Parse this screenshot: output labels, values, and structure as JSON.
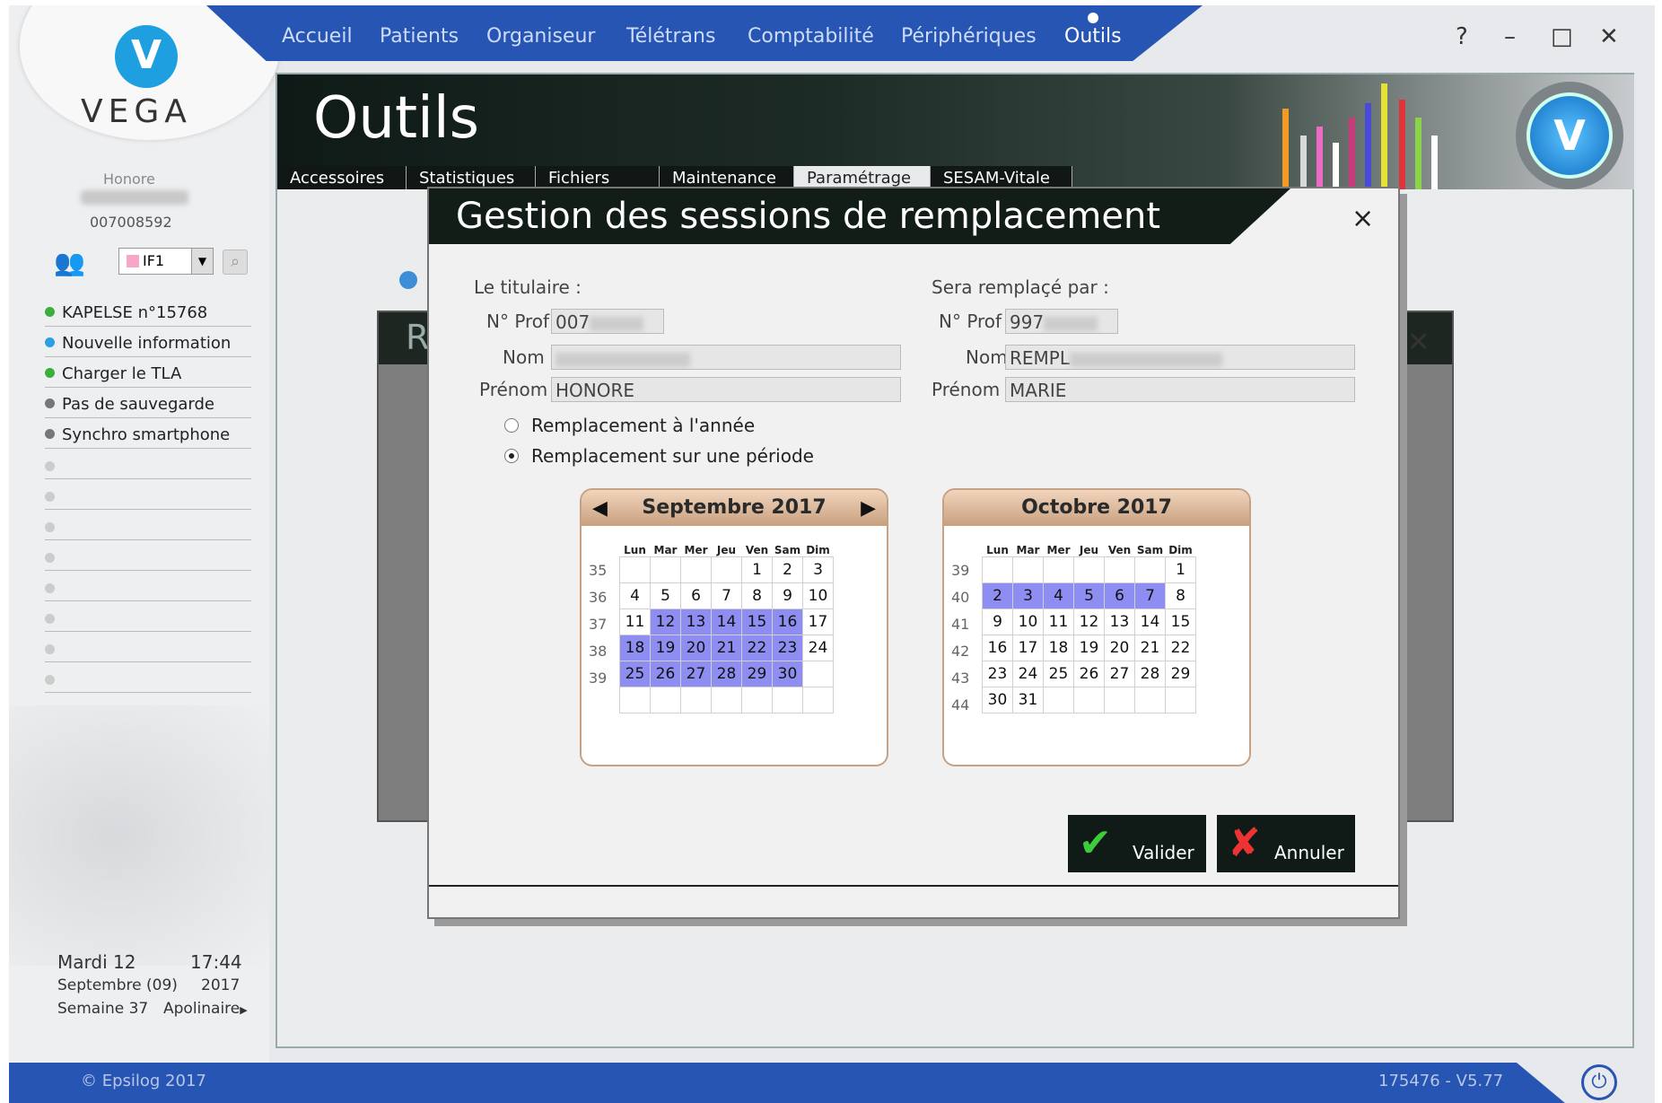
{
  "nav": {
    "items": [
      {
        "label": "Accueil"
      },
      {
        "label": "Patients"
      },
      {
        "label": "Organiseur"
      },
      {
        "label": "Télétrans"
      },
      {
        "label": "Comptabilité"
      },
      {
        "label": "Périphériques"
      },
      {
        "label": "Outils"
      }
    ],
    "active": "Outils"
  },
  "window_controls": {
    "help": "?",
    "minimize": "–",
    "maximize": "□",
    "close": "✕"
  },
  "sidebar": {
    "logo_text": "VEGA",
    "user_first": "Honore",
    "user_id": "007008592",
    "if_label": "IF1",
    "links": [
      {
        "label": "KAPELSE n°15768",
        "color": "#3cae3c"
      },
      {
        "label": "Nouvelle information",
        "color": "#2a9fe6"
      },
      {
        "label": "Charger le TLA",
        "color": "#3cae3c"
      },
      {
        "label": "Pas de sauvegarde",
        "color": "#777777"
      },
      {
        "label": "Synchro smartphone",
        "color": "#777777"
      }
    ],
    "date": {
      "day": "Mardi 12",
      "time": "17:44",
      "month": "Septembre (09)",
      "year": "2017",
      "week": "Semaine 37",
      "saint": "Apolinaire"
    }
  },
  "header": {
    "title": "Outils",
    "tabs": [
      {
        "label": "Accessoires"
      },
      {
        "label": "Statistiques"
      },
      {
        "label": "Fichiers"
      },
      {
        "label": "Maintenance"
      },
      {
        "label": "Paramétrage"
      },
      {
        "label": "SESAM-Vitale"
      }
    ],
    "active_tab": "Paramétrage"
  },
  "background_dialog": {
    "title_partial": "Re"
  },
  "dialog": {
    "title": "Gestion des sessions de remplacement",
    "close": "×",
    "titulaire": {
      "heading": "Le titulaire :",
      "nprof_label": "N° Prof",
      "nprof_value": "007",
      "nom_label": "Nom",
      "prenom_label": "Prénom",
      "prenom_value": "HONORE"
    },
    "remplacant": {
      "heading": "Sera remplaçé par :",
      "nprof_label": "N° Prof",
      "nprof_value": "997",
      "nom_label": "Nom",
      "nom_value": "REMPL",
      "prenom_label": "Prénom",
      "prenom_value": "MARIE"
    },
    "options": [
      {
        "label": "Remplacement à l'année",
        "checked": false
      },
      {
        "label": "Remplacement sur une période",
        "checked": true
      }
    ],
    "calendars": [
      {
        "title": "Septembre 2017",
        "weekdays": [
          "Lun",
          "Mar",
          "Mer",
          "Jeu",
          "Ven",
          "Sam",
          "Dim"
        ],
        "weeks": [
          "35",
          "36",
          "37",
          "38",
          "39",
          ""
        ],
        "days": [
          [
            "",
            "",
            "",
            "",
            "1",
            "2",
            "3"
          ],
          [
            "4",
            "5",
            "6",
            "7",
            "8",
            "9",
            "10"
          ],
          [
            "11",
            "12",
            "13",
            "14",
            "15",
            "16",
            "17"
          ],
          [
            "18",
            "19",
            "20",
            "21",
            "22",
            "23",
            "24"
          ],
          [
            "25",
            "26",
            "27",
            "28",
            "29",
            "30",
            ""
          ],
          [
            "",
            "",
            "",
            "",
            "",
            "",
            ""
          ]
        ],
        "selected": [
          "12",
          "13",
          "14",
          "15",
          "16",
          "18",
          "19",
          "20",
          "21",
          "22",
          "23",
          "25",
          "26",
          "27",
          "28",
          "29",
          "30"
        ]
      },
      {
        "title": "Octobre 2017",
        "weekdays": [
          "Lun",
          "Mar",
          "Mer",
          "Jeu",
          "Ven",
          "Sam",
          "Dim"
        ],
        "weeks": [
          "39",
          "40",
          "41",
          "42",
          "43",
          "44"
        ],
        "days": [
          [
            "",
            "",
            "",
            "",
            "",
            "",
            "1"
          ],
          [
            "2",
            "3",
            "4",
            "5",
            "6",
            "7",
            "8"
          ],
          [
            "9",
            "10",
            "11",
            "12",
            "13",
            "14",
            "15"
          ],
          [
            "16",
            "17",
            "18",
            "19",
            "20",
            "21",
            "22"
          ],
          [
            "23",
            "24",
            "25",
            "26",
            "27",
            "28",
            "29"
          ],
          [
            "30",
            "31",
            "",
            "",
            "",
            "",
            ""
          ]
        ],
        "selected": [
          "2",
          "3",
          "4",
          "5",
          "6",
          "7"
        ]
      }
    ],
    "validate_label": "Valider",
    "cancel_label": "Annuler"
  },
  "footer": {
    "copyright": "© Epsilog 2017",
    "version": "175476 - V5.77"
  },
  "colors": {
    "nav_blue": "#2655b4",
    "selected_day": "#8e8ef2",
    "dark_header": "#121d18"
  }
}
